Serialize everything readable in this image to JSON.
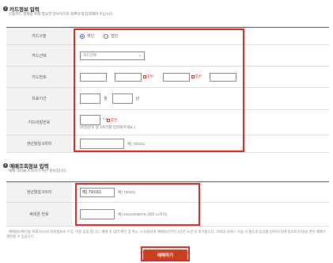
{
  "section1": {
    "number": "1",
    "title": "카드정보 입력",
    "subtitle": "· 신용카드 결제를 위해 필요한 정보이므로 정확하게 입력해야 주십시오.",
    "rows": {
      "card_type": {
        "label": "카드구분",
        "option_personal": "개인",
        "option_corporate": "법인"
      },
      "card_select": {
        "label": "카드선택",
        "placeholder": "카드선택"
      },
      "card_number": {
        "label": "카드번호",
        "mask_label_1": "후번",
        "mask_label_2": "후번"
      },
      "expiry": {
        "label": "유효기간",
        "month_unit": "월",
        "year_unit": "년"
      },
      "password": {
        "label": "카드비밀번호",
        "mask": "* * ",
        "mask_label": "후번",
        "hint": "(비밀번호 앞 2자리를 입력해주세요.)"
      },
      "birth": {
        "label": "생년월일 6자리",
        "hint": "예) 750101"
      }
    }
  },
  "section2": {
    "number": "2",
    "title": "예매조회정보 입력",
    "subtitle": "· 예매 내역을 조회하기 위한 정보입니다.",
    "rows": {
      "birth": {
        "label": "생년월일 6자리",
        "value": "예) 750101",
        "hint": "예) 750101"
      },
      "phone": {
        "label": "휴대폰 번호",
        "hint": "예) 01012345678 (최대 11자리)"
      }
    }
  },
  "notice": "· 예매정보확인을 위해 KTX의 회원정보로 수집, 이용 동의 합니다. 예매 후 내역 확인 및 취소 시 사용되며 예매일로부터 1년간 보관 후 파기됩니다. 이외의 서비스 이용 시 별도의 동의를 받아야 하며 동의하지 않을 경우 예매가 제한될 수 있습니다.",
  "button": {
    "reserve": "예매하기"
  }
}
